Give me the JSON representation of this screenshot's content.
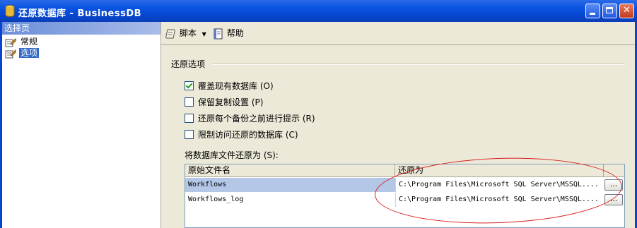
{
  "window": {
    "title": "还原数据库 - BusinessDB",
    "buttons": {
      "minimize": "minimize",
      "maximize": "maximize",
      "close": "✕"
    }
  },
  "sidebar": {
    "header": "选择页",
    "items": [
      {
        "label": "常规",
        "icon": "page-icon",
        "selected": false
      },
      {
        "label": "选项",
        "icon": "page-icon",
        "selected": true
      }
    ]
  },
  "toolbar": {
    "script_label": "脚本",
    "help_label": "帮助"
  },
  "restore_options": {
    "section_title": "还原选项",
    "options": [
      {
        "label": "覆盖现有数据库 (O)",
        "checked": true
      },
      {
        "label": "保留复制设置 (P)",
        "checked": false
      },
      {
        "label": "还原每个备份之前进行提示 (R)",
        "checked": false
      },
      {
        "label": "限制访问还原的数据库 (C)",
        "checked": false
      }
    ]
  },
  "files": {
    "label": "将数据库文件还原为 (S):",
    "columns": [
      "原始文件名",
      "还原为"
    ],
    "rows": [
      {
        "original": "Workflows",
        "restore_as": "C:\\Program Files\\Microsoft SQL Server\\MSSQL....",
        "browse": "..."
      },
      {
        "original": "Workflows_log",
        "restore_as": "C:\\Program Files\\Microsoft SQL Server\\MSSQL....",
        "browse": "..."
      }
    ]
  },
  "colors": {
    "titlebar": "#0a55e0",
    "selection": "#316ac5",
    "annotation": "#d81e1e"
  }
}
